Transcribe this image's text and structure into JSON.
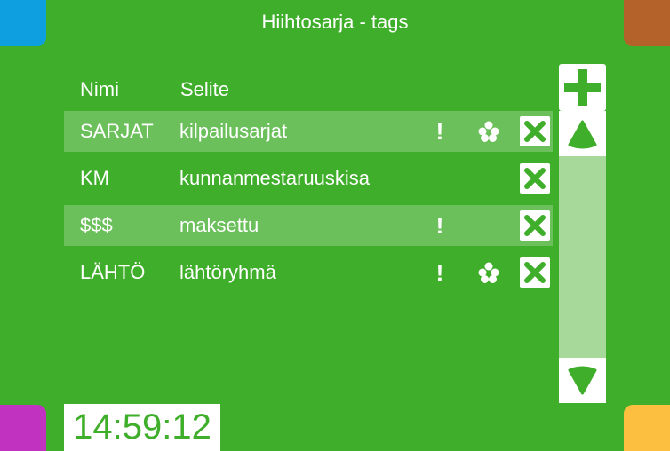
{
  "header": {
    "title": "Hiihtosarja - tags"
  },
  "columns": {
    "name": "Nimi",
    "description": "Selite"
  },
  "rows": [
    {
      "name": "SARJAT",
      "description": "kilpailusarjat",
      "exclamation": "!",
      "has_exclamation": true,
      "has_flower": true
    },
    {
      "name": "KM",
      "description": "kunnanmestaruuskisa",
      "exclamation": "",
      "has_exclamation": false,
      "has_flower": false
    },
    {
      "name": "$$$",
      "description": "maksettu",
      "exclamation": "!",
      "has_exclamation": true,
      "has_flower": false
    },
    {
      "name": "LÄHTÖ",
      "description": "lähtöryhmä",
      "exclamation": "!",
      "has_exclamation": true,
      "has_flower": true
    }
  ],
  "clock": {
    "time": "14:59:12"
  },
  "icons": {
    "add": "plus-icon",
    "delete": "close-x-icon",
    "flower": "flower-icon",
    "scroll_up": "triangle-up-icon",
    "scroll_down": "triangle-down-icon"
  },
  "colors": {
    "background": "#3fae2a",
    "row_highlight": "#6cc05c",
    "scroll_track": "#a6d99a",
    "corner_top_left": "#0d9fe0",
    "corner_top_right": "#b5612a",
    "corner_bottom_left": "#c132c0",
    "corner_bottom_right": "#fdbf3f"
  }
}
